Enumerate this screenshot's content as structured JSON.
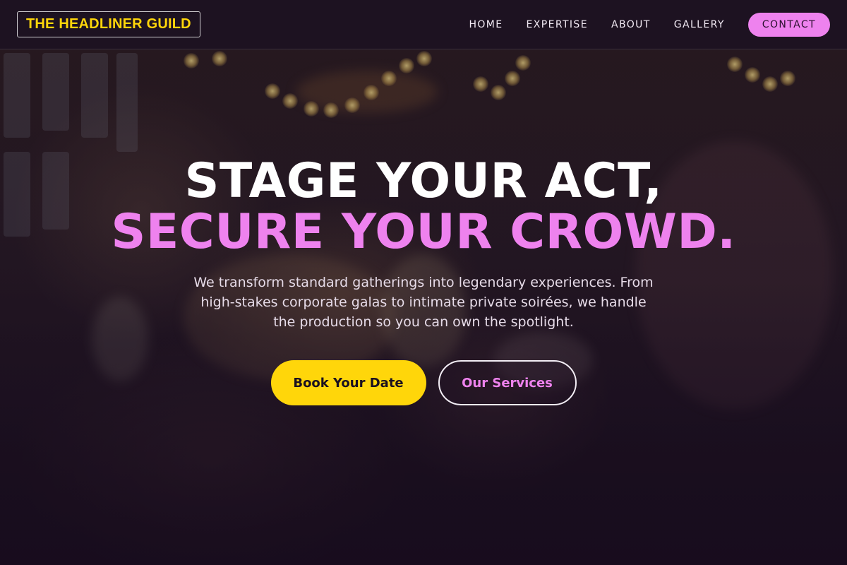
{
  "nav": {
    "logo": "THE HEADLINER GUILD",
    "links": [
      "HOME",
      "EXPERTISE",
      "ABOUT",
      "GALLERY"
    ],
    "cta": "CONTACT"
  },
  "hero": {
    "headline_line1": "STAGE YOUR ACT,",
    "headline_line2": "SECURE YOUR CROWD.",
    "subtitle": "We transform standard gatherings into legendary experiences. From high-stakes corporate galas to intimate private soirées, we handle the production so you can own the spotlight.",
    "primary_button": "Book Your Date",
    "secondary_button": "Our Services"
  },
  "colors": {
    "accent_yellow": "#ffd60a",
    "accent_pink": "#ee82ee",
    "background": "#1a0f1e"
  }
}
